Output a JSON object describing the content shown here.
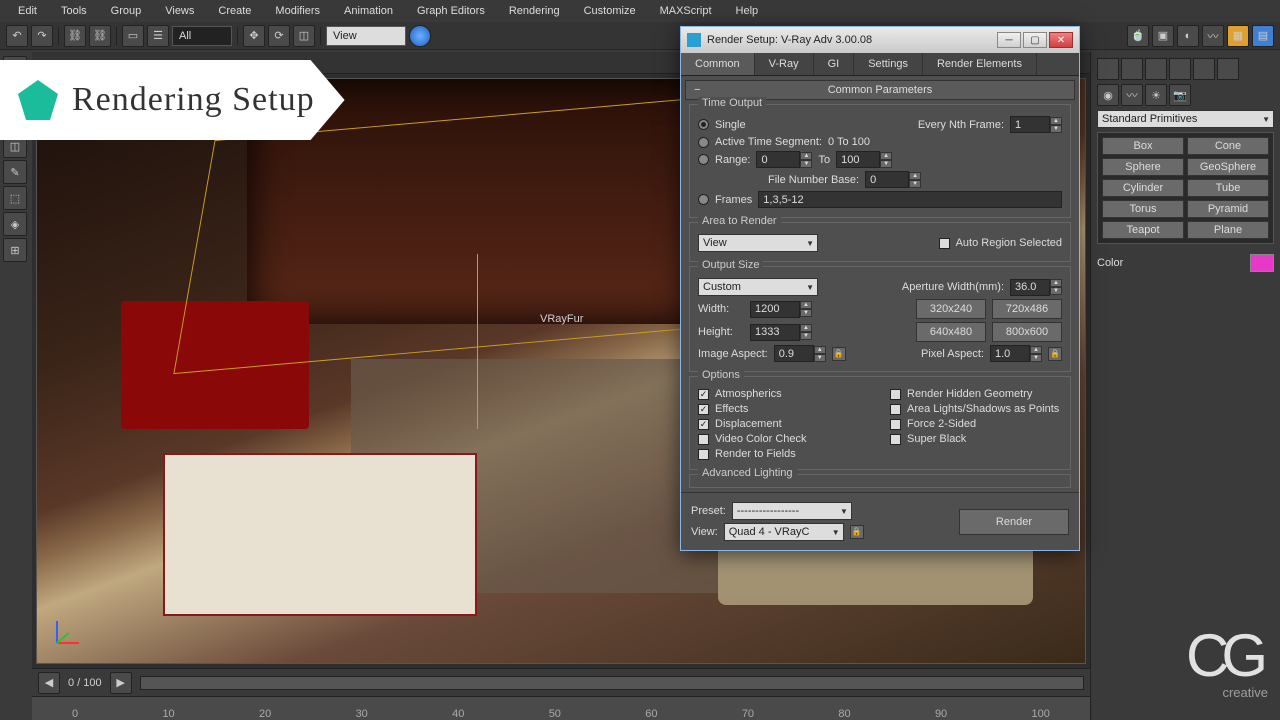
{
  "menu": [
    "Edit",
    "Tools",
    "Group",
    "Views",
    "Create",
    "Modifiers",
    "Animation",
    "Graph Editors",
    "Rendering",
    "Customize",
    "MAXScript",
    "Help"
  ],
  "toolbar": {
    "viewDrop": "View"
  },
  "banner": {
    "title": "Rendering Setup"
  },
  "viewport": {
    "label": "VRayFur"
  },
  "timeline": {
    "frameStatus": "0 / 100",
    "ticks": [
      "0",
      "10",
      "20",
      "30",
      "40",
      "50",
      "60",
      "70",
      "80",
      "90",
      "100"
    ]
  },
  "rightPanel": {
    "objTypes": [
      "Box",
      "Cone",
      "Sphere",
      "GeoSphere",
      "Cylinder",
      "Tube",
      "Torus",
      "Pyramid",
      "Teapot",
      "Plane"
    ],
    "colorLabel": "Color"
  },
  "dialog": {
    "title": "Render Setup: V-Ray Adv 3.00.08",
    "tabs": [
      "Common",
      "V-Ray",
      "GI",
      "Settings",
      "Render Elements"
    ],
    "rollout1": "Common Parameters",
    "timeOutput": {
      "title": "Time Output",
      "single": "Single",
      "nthLabel": "Every Nth Frame:",
      "nthVal": "1",
      "activeSeg": "Active Time Segment:",
      "activeRange": "0 To 100",
      "range": "Range:",
      "rangeFrom": "0",
      "rangeToLbl": "To",
      "rangeTo": "100",
      "fileNumBase": "File Number Base:",
      "fileNumVal": "0",
      "frames": "Frames",
      "framesVal": "1,3,5-12"
    },
    "area": {
      "title": "Area to Render",
      "sel": "View",
      "autoRegion": "Auto Region Selected"
    },
    "outputSize": {
      "title": "Output Size",
      "preset": "Custom",
      "apertureLbl": "Aperture Width(mm):",
      "apertureVal": "36.0",
      "widthLbl": "Width:",
      "widthVal": "1200",
      "heightLbl": "Height:",
      "heightVal": "1333",
      "presets": [
        "320x240",
        "720x486",
        "640x480",
        "800x600"
      ],
      "imgAspectLbl": "Image Aspect:",
      "imgAspectVal": "0.9",
      "pixAspectLbl": "Pixel Aspect:",
      "pixAspectVal": "1.0"
    },
    "options": {
      "title": "Options",
      "left": [
        "Atmospherics",
        "Effects",
        "Displacement",
        "Video Color Check",
        "Render to Fields"
      ],
      "leftChecked": [
        true,
        true,
        true,
        false,
        false
      ],
      "right": [
        "Render Hidden Geometry",
        "Area Lights/Shadows as Points",
        "Force 2-Sided",
        "Super Black"
      ],
      "rightChecked": [
        false,
        false,
        false,
        false
      ]
    },
    "advLighting": "Advanced Lighting",
    "footer": {
      "presetLbl": "Preset:",
      "presetVal": "-----------------",
      "viewLbl": "View:",
      "viewVal": "Quad 4 - VRayC",
      "renderBtn": "Render"
    }
  },
  "logo": {
    "main": "CG",
    "sub": "creative"
  }
}
